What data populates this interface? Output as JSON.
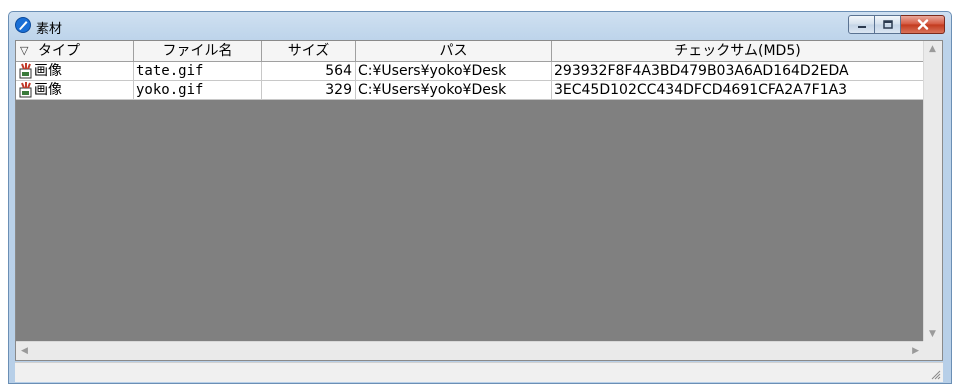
{
  "window": {
    "title": "素材",
    "icon": "app-icon"
  },
  "grid": {
    "columns": [
      {
        "key": "type",
        "label": "タイプ",
        "sort_indicator": "▽"
      },
      {
        "key": "filename",
        "label": "ファイル名"
      },
      {
        "key": "size",
        "label": "サイズ"
      },
      {
        "key": "path",
        "label": "パス"
      },
      {
        "key": "checksum",
        "label": "チェックサム(MD5)"
      }
    ],
    "rows": [
      {
        "type": "画像",
        "filename": "tate.gif",
        "size": "564",
        "path": "C:¥Users¥yoko¥Desk",
        "checksum": "293932F8F4A3BD479B03A6AD164D2EDA"
      },
      {
        "type": "画像",
        "filename": "yoko.gif",
        "size": "329",
        "path": "C:¥Users¥yoko¥Desk",
        "checksum": "3EC45D102CC434DFCD4691CFA2A7F1A3"
      }
    ]
  },
  "colors": {
    "titlebar": "#bcd3ea",
    "client_bg": "#808080",
    "close_button": "#c2391d"
  }
}
